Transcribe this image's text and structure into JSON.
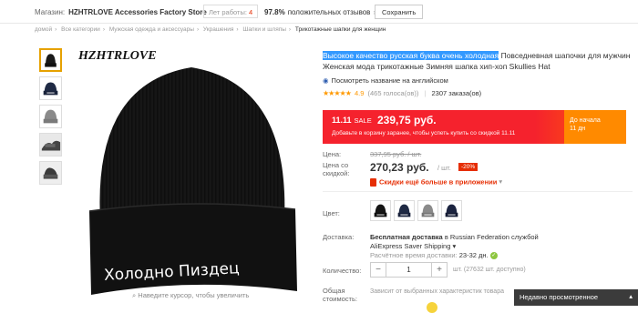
{
  "topbar": {
    "shop_label": "Магазин:",
    "shop_name": "HZHTRLOVE Accessories Factory Store",
    "years_label": "Лет работы:",
    "years_value": "4",
    "rating_percent": "97.8%",
    "rating_text": "положительных отзывов",
    "save_label": "Сохранить"
  },
  "breadcrumbs": [
    "домой",
    "Все категории",
    "Мужская одежда и аксессуары",
    "Украшения",
    "Шапки и шляпы",
    "Трикотажные шапки для женщин"
  ],
  "gallery": {
    "brand": "HZHTRLOVE",
    "hat_text": "Холодно Пиздец",
    "zoom_hint": "Наведите курсор, чтобы увеличить",
    "thumb_count": 5
  },
  "product": {
    "title_highlight": "Высокое качество русская буква очень холодная",
    "title_rest": " Повседневная шапочки для мужчин Женская мода трикотажные Зимняя шапка хип-хоп Skullies Hat",
    "translate_link": "Посмотреть название на английском",
    "stars": "★★★★★",
    "rating_score": "4.9",
    "rating_votes": "(465 голоса(ов))",
    "orders": "2307 заказа(ов)"
  },
  "sale": {
    "label": "11.11",
    "label_suffix": "SALE",
    "price": "239,75 руб.",
    "note": "Добавьте в корзину заранее, чтобы успеть купить со скидкой 11.11",
    "countdown_line1": "До начала",
    "countdown_line2": "11 дн"
  },
  "pricing": {
    "old_label": "Цена:",
    "old_price": "337,95 руб. / шт.",
    "disc_label_1": "Цена со",
    "disc_label_2": "скидкой:",
    "disc_price": "270,23 руб.",
    "disc_unit": "/ шт.",
    "disc_badge": "-20%",
    "app_text": "Скидки ещё больше в приложении",
    "app_chev": "▾"
  },
  "options": {
    "color_label": "Цвет:",
    "swatches": [
      "black-hat",
      "navy-hat",
      "gray-hat",
      "navy-hat-2"
    ]
  },
  "shipping": {
    "label": "Доставка:",
    "free_bold": "Бесплатная доставка",
    "free_rest": " в Russian Federation службой",
    "service": "AliExpress Saver Shipping",
    "eta_label": "Расчётное время доставки:",
    "eta_value": "23-32 дн."
  },
  "quantity": {
    "label": "Количество:",
    "minus": "−",
    "value": "1",
    "plus": "+",
    "available": "шт. (27632 шт. доступно)"
  },
  "total": {
    "label_1": "Общая",
    "label_2": "стоимость:",
    "value": "Зависит от выбранных характеристик товара"
  },
  "recent": {
    "label": "Недавно просмотренное",
    "chev": "▴"
  },
  "colors": {
    "accent": "#e62e04",
    "sale_red": "#f5222d",
    "sale_orange": "#ff8a00",
    "star": "#ff9900",
    "highlight": "#3399ff"
  }
}
